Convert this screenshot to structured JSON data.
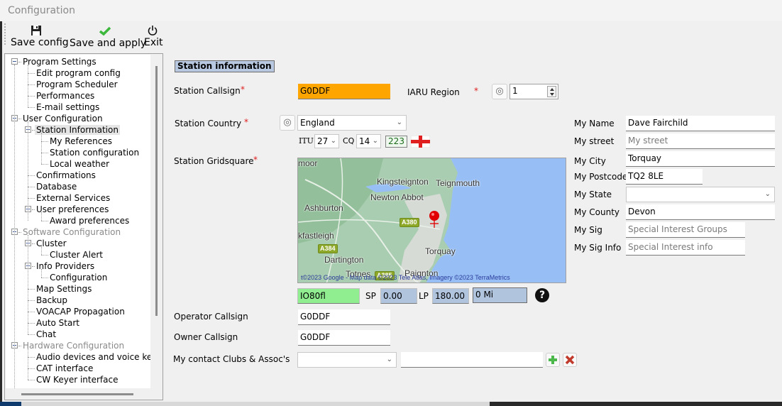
{
  "window": {
    "title": "Configuration"
  },
  "toolbar": {
    "save_config": {
      "label": "Save config",
      "icon": "floppy-disk-icon"
    },
    "save_apply": {
      "label": "Save and apply",
      "icon": "check-icon"
    },
    "exit": {
      "label": "Exit",
      "icon": "power-icon"
    }
  },
  "tree": {
    "items": [
      {
        "label": "Program Settings",
        "level": 0,
        "expanded": true
      },
      {
        "label": "Edit program config",
        "level": 1
      },
      {
        "label": "Program Scheduler",
        "level": 1
      },
      {
        "label": "Performances",
        "level": 1
      },
      {
        "label": "E-mail settings",
        "level": 1
      },
      {
        "label": "User Configuration",
        "level": 0,
        "expanded": true
      },
      {
        "label": "Station Information",
        "level": 1,
        "expanded": true,
        "selected": true
      },
      {
        "label": "My References",
        "level": 2
      },
      {
        "label": "Station configuration",
        "level": 2
      },
      {
        "label": "Local weather",
        "level": 2
      },
      {
        "label": "Confirmations",
        "level": 1
      },
      {
        "label": "Database",
        "level": 1
      },
      {
        "label": "External Services",
        "level": 1
      },
      {
        "label": "User preferences",
        "level": 1,
        "expanded": true
      },
      {
        "label": "Award preferences",
        "level": 2
      },
      {
        "label": "Software Configuration",
        "level": 0,
        "expanded": true,
        "disabled": true
      },
      {
        "label": "Cluster",
        "level": 1,
        "expanded": true
      },
      {
        "label": "Cluster Alert",
        "level": 2
      },
      {
        "label": "Info Providers",
        "level": 1,
        "expanded": true
      },
      {
        "label": "Configuration",
        "level": 2
      },
      {
        "label": "Map Settings",
        "level": 1
      },
      {
        "label": "Backup",
        "level": 1
      },
      {
        "label": "VOACAP Propagation",
        "level": 1
      },
      {
        "label": "Auto Start",
        "level": 1
      },
      {
        "label": "Chat",
        "level": 1
      },
      {
        "label": "Hardware Configuration",
        "level": 0,
        "expanded": true,
        "disabled": true
      },
      {
        "label": "Audio devices and voice keye",
        "level": 1
      },
      {
        "label": "CAT interface",
        "level": 1
      },
      {
        "label": "CW Keyer interface",
        "level": 1
      }
    ]
  },
  "form": {
    "section_title": "Station information",
    "required_mark": "*",
    "station_callsign": {
      "label": "Station Callsign",
      "value": "G0DDF"
    },
    "iaru_region": {
      "label": "IARU Region",
      "value": "1"
    },
    "station_country": {
      "label": "Station Country",
      "value": "England"
    },
    "itu": {
      "label": "ITU",
      "value": "27"
    },
    "cq": {
      "label": "CQ",
      "value": "14"
    },
    "dxcc": "223",
    "station_gridsquare": {
      "label": "Station Gridsquare",
      "value": "IO80fl"
    },
    "sp": {
      "label": "SP",
      "value": "0.00"
    },
    "lp": {
      "label": "LP",
      "value": "180.00"
    },
    "distance": "0 Mi",
    "operator_callsign": {
      "label": "Operator Callsign",
      "value": "G0DDF"
    },
    "owner_callsign": {
      "label": "Owner Callsign",
      "value": "G0DDF"
    },
    "clubs": {
      "label": "My contact Clubs & Assoc's",
      "value": "",
      "text": ""
    }
  },
  "personal": {
    "name": {
      "label": "My Name",
      "value": "Dave Fairchild"
    },
    "street": {
      "label": "My street",
      "placeholder": "My street"
    },
    "city": {
      "label": "My City",
      "value": "Torquay"
    },
    "postcode": {
      "label": "My Postcode",
      "value": "TQ2 8LE"
    },
    "state": {
      "label": "My State",
      "value": ""
    },
    "county": {
      "label": "My County",
      "value": "Devon"
    },
    "sig": {
      "label": "My Sig",
      "placeholder": "Special Interest Groups"
    },
    "sig_info": {
      "label": "My Sig Info",
      "placeholder": "Special Interest info"
    }
  },
  "map": {
    "places": [
      "moor",
      "Kingsteignton",
      "Teignmouth",
      "Newton Abbot",
      "Ashburton",
      "kfastleigh",
      "Dartington",
      "Torquay",
      "Totnes",
      "Paignton"
    ],
    "roads": [
      "A380",
      "A384",
      "A385"
    ],
    "copyright": "t©2023 Google - Map data ©2023 Tele Atlas, Imagery ©2023 TerraMetrics"
  },
  "colors": {
    "callsign_bg": "#ffa500",
    "grid_bg": "#90ee90",
    "bearing_bg": "#b0c4de",
    "section_bg": "#b8c8e0",
    "required": "#e02020"
  }
}
